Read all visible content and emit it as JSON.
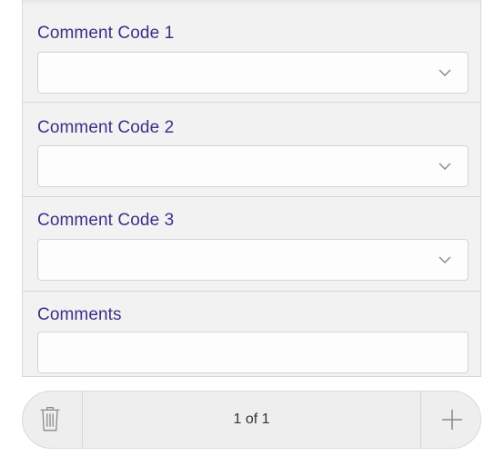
{
  "form": {
    "fields": [
      {
        "label": "Comment Code 1",
        "value": "",
        "type": "dropdown"
      },
      {
        "label": "Comment Code 2",
        "value": "",
        "type": "dropdown"
      },
      {
        "label": "Comment Code 3",
        "value": "",
        "type": "dropdown"
      },
      {
        "label": "Comments",
        "value": "",
        "type": "text"
      }
    ]
  },
  "pager": {
    "text": "1 of 1",
    "delete_icon": "trash-icon",
    "add_icon": "plus-icon"
  },
  "colors": {
    "label": "#3b3187",
    "panel_bg": "#f2f2f2"
  }
}
